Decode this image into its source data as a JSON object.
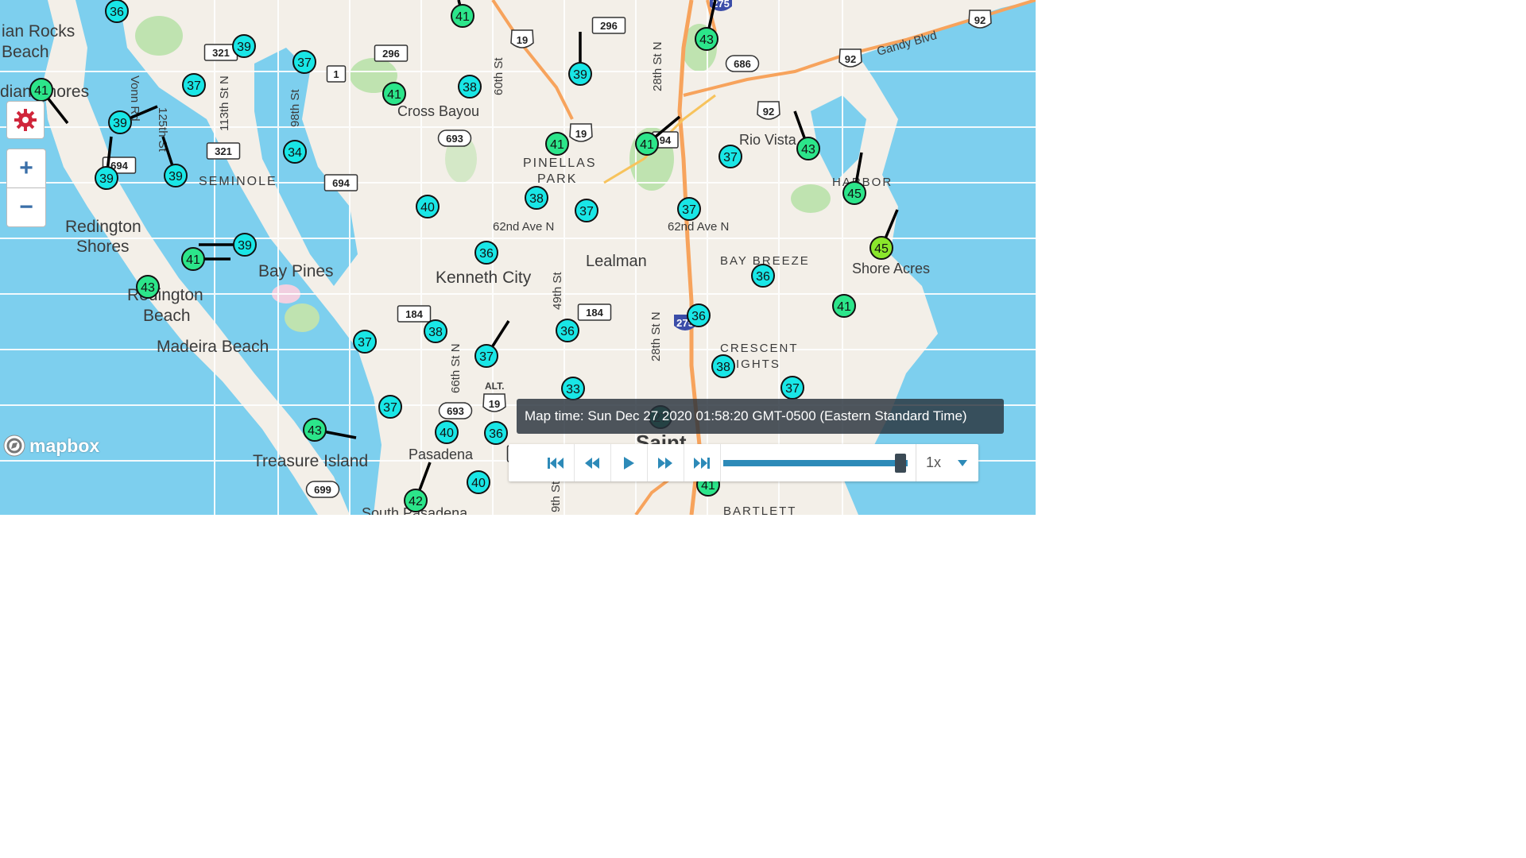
{
  "map": {
    "places": [
      {
        "id": "indian-rocks-beach-1",
        "text": "ian Rocks"
      },
      {
        "id": "indian-rocks-beach-2",
        "text": "Beach"
      },
      {
        "id": "indian-shores",
        "text": "dian Shores"
      },
      {
        "id": "cross-bayou",
        "text": "Cross Bayou"
      },
      {
        "id": "pinellas-park-1",
        "text": "PINELLAS"
      },
      {
        "id": "pinellas-park-2",
        "text": "PARK"
      },
      {
        "id": "rio-vista",
        "text": "Rio Vista"
      },
      {
        "id": "harbor-1",
        "text": "HARBOR"
      },
      {
        "id": "seminole",
        "text": "SEMINOLE"
      },
      {
        "id": "redington-shores-1",
        "text": "Redington"
      },
      {
        "id": "redington-shores-2",
        "text": "Shores"
      },
      {
        "id": "bay-pines",
        "text": "Bay Pines"
      },
      {
        "id": "redington-beach-1",
        "text": "Redington"
      },
      {
        "id": "redington-beach-2",
        "text": "Beach"
      },
      {
        "id": "kenneth-city",
        "text": "Kenneth City"
      },
      {
        "id": "lealman",
        "text": "Lealman"
      },
      {
        "id": "bay-breeze",
        "text": "BAY BREEZE"
      },
      {
        "id": "shore-acres",
        "text": "Shore Acres"
      },
      {
        "id": "madeira-beach",
        "text": "Madeira Beach"
      },
      {
        "id": "crescent-heights-1",
        "text": "CRESCENT"
      },
      {
        "id": "crescent-heights-2",
        "text": "EIGHTS"
      },
      {
        "id": "treasure-island",
        "text": "Treasure Island"
      },
      {
        "id": "pasadena",
        "text": "Pasadena"
      },
      {
        "id": "saint",
        "text": "Saint"
      },
      {
        "id": "bartlett",
        "text": "BARTLETT"
      },
      {
        "id": "south-pasadena",
        "text": "South Pasadena"
      }
    ],
    "streets": [
      {
        "id": "vonn-rd",
        "text": "Vonn Rd"
      },
      {
        "id": "125th-st",
        "text": "125th St"
      },
      {
        "id": "113th-st-n",
        "text": "113th St N"
      },
      {
        "id": "98th-st",
        "text": "98th St"
      },
      {
        "id": "60th-st",
        "text": "60th St"
      },
      {
        "id": "28th-st-n-top",
        "text": "28th St N"
      },
      {
        "id": "62nd-ave-n-1",
        "text": "62nd Ave N"
      },
      {
        "id": "62nd-ave-n-2",
        "text": "62nd Ave N"
      },
      {
        "id": "49th-st",
        "text": "49th St"
      },
      {
        "id": "66th-st-n",
        "text": "66th St N"
      },
      {
        "id": "28th-st-n-bottom",
        "text": "28th St N"
      },
      {
        "id": "gandy-blvd",
        "text": "Gandy Blvd"
      },
      {
        "id": "9th-st",
        "text": "9th St"
      },
      {
        "id": "alt",
        "text": "ALT."
      }
    ],
    "shields": [
      {
        "id": "s296a",
        "text": "296"
      },
      {
        "id": "s296b",
        "text": "296"
      },
      {
        "id": "s321a",
        "text": "321"
      },
      {
        "id": "s321b",
        "text": "321"
      },
      {
        "id": "s1",
        "text": "1"
      },
      {
        "id": "s19a",
        "text": "19"
      },
      {
        "id": "s19b",
        "text": "19"
      },
      {
        "id": "s19c",
        "text": "19"
      },
      {
        "id": "s693a",
        "text": "693"
      },
      {
        "id": "s693b",
        "text": "693"
      },
      {
        "id": "s694a",
        "text": "694"
      },
      {
        "id": "s694b",
        "text": "94"
      },
      {
        "id": "s686",
        "text": "686"
      },
      {
        "id": "s92a",
        "text": "92"
      },
      {
        "id": "s92b",
        "text": "92"
      },
      {
        "id": "s92c",
        "text": "92"
      },
      {
        "id": "s184a",
        "text": "184"
      },
      {
        "id": "s184b",
        "text": "184"
      },
      {
        "id": "s150",
        "text": "150"
      },
      {
        "id": "s699",
        "text": "699"
      },
      {
        "id": "s275a",
        "text": "275"
      },
      {
        "id": "s275b",
        "text": "275"
      },
      {
        "id": "s694c",
        "text": "694"
      }
    ],
    "stations": [
      {
        "v": "36",
        "c": "#19e6e6"
      },
      {
        "v": "39",
        "c": "#19e6e6"
      },
      {
        "v": "37",
        "c": "#19e6e6"
      },
      {
        "v": "41",
        "c": "#2ce58a"
      },
      {
        "v": "38",
        "c": "#19e6e6"
      },
      {
        "v": "39",
        "c": "#19e6e6"
      },
      {
        "v": "43",
        "c": "#2ce58a"
      },
      {
        "v": "41",
        "c": "#2ce58a"
      },
      {
        "v": "37",
        "c": "#19e6e6"
      },
      {
        "v": "39",
        "c": "#19e6e6"
      },
      {
        "v": "41",
        "c": "#2ce58a"
      },
      {
        "v": "34",
        "c": "#19e6e6"
      },
      {
        "v": "41",
        "c": "#2ce58a"
      },
      {
        "v": "41",
        "c": "#2ce58a"
      },
      {
        "v": "37",
        "c": "#19e6e6"
      },
      {
        "v": "43",
        "c": "#2ce58a"
      },
      {
        "v": "39",
        "c": "#19e6e6"
      },
      {
        "v": "39",
        "c": "#19e6e6"
      },
      {
        "v": "45",
        "c": "#2ce58a"
      },
      {
        "v": "40",
        "c": "#19e6e6"
      },
      {
        "v": "38",
        "c": "#19e6e6"
      },
      {
        "v": "37",
        "c": "#19e6e6"
      },
      {
        "v": "37",
        "c": "#19e6e6"
      },
      {
        "v": "39",
        "c": "#19e6e6"
      },
      {
        "v": "45",
        "c": "#8ae62c"
      },
      {
        "v": "41",
        "c": "#2ce58a"
      },
      {
        "v": "36",
        "c": "#19e6e6"
      },
      {
        "v": "36",
        "c": "#19e6e6"
      },
      {
        "v": "43",
        "c": "#2ce58a"
      },
      {
        "v": "41",
        "c": "#2ce58a"
      },
      {
        "v": "36",
        "c": "#19e6e6"
      },
      {
        "v": "38",
        "c": "#19e6e6"
      },
      {
        "v": "36",
        "c": "#19e6e6"
      },
      {
        "v": "37",
        "c": "#19e6e6"
      },
      {
        "v": "37",
        "c": "#19e6e6"
      },
      {
        "v": "38",
        "c": "#19e6e6"
      },
      {
        "v": "33",
        "c": "#19e6e6"
      },
      {
        "v": "37",
        "c": "#19e6e6"
      },
      {
        "v": "37",
        "c": "#19e6e6"
      },
      {
        "v": "43",
        "c": "#2ce58a"
      },
      {
        "v": "40",
        "c": "#19e6e6"
      },
      {
        "v": "36",
        "c": "#19e6e6"
      },
      {
        "v": "27",
        "c": "#1a8a6a"
      },
      {
        "v": "40",
        "c": "#19e6e6"
      },
      {
        "v": "42",
        "c": "#2ce58a"
      },
      {
        "v": "41",
        "c": "#2ce58a"
      }
    ]
  },
  "controls": {
    "zoom_in": "+",
    "zoom_out": "−",
    "gear_icon": "gear-icon"
  },
  "tooltip": "Map time: Sun Dec 27 2020 01:58:20 GMT-0500 (Eastern Standard Time)",
  "player": {
    "progress": 0.96,
    "speed": "1x"
  },
  "logo": "mapbox",
  "colors": {
    "water": "#7dcfee",
    "land": "#f4f1ec",
    "park": "#bfe3b0",
    "accent": "#2d8ab8"
  }
}
